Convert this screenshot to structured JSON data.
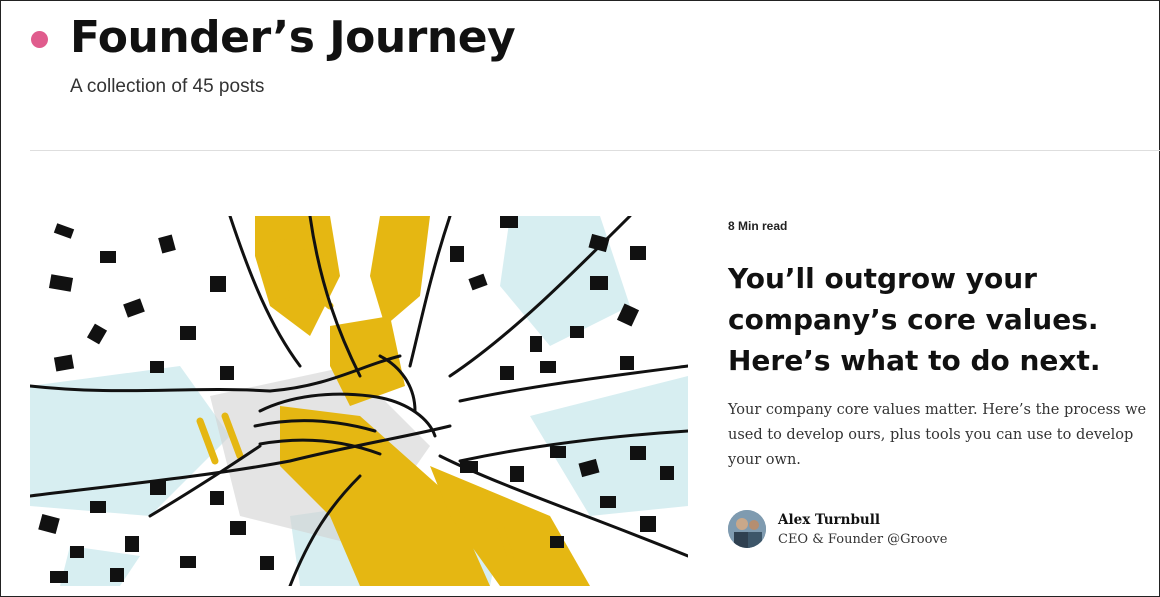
{
  "collection": {
    "title": "Founder’s Journey",
    "subtitle": "A collection of 45 posts",
    "accent_color": "#e05c8d"
  },
  "featured_post": {
    "read_time": "8 Min read",
    "title": "You’ll outgrow your company’s core values. Here’s what to do next.",
    "excerpt": "Your company core values matter. Here’s the process we used to develop ours, plus tools you can use to develop your own.",
    "illustration": "stacked-hands-illustration",
    "illustration_colors": [
      "#e5b712",
      "#111111",
      "#d7eef1",
      "#d2d2d2"
    ],
    "author": {
      "name": "Alex Turnbull",
      "role": "CEO & Founder @Groove",
      "avatar_icon": "author-avatar"
    }
  }
}
